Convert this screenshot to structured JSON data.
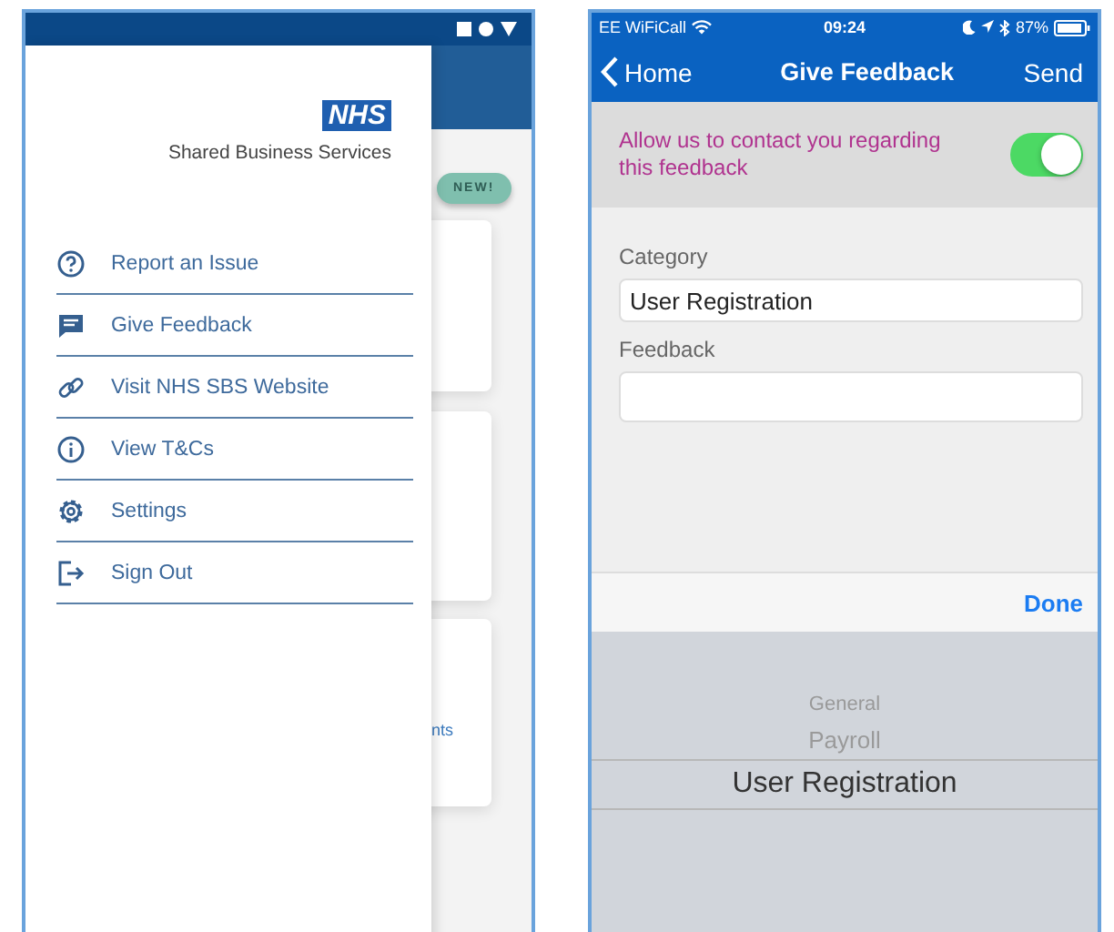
{
  "left_phone": {
    "logo": {
      "badge": "NHS",
      "name": "Shared Business Services"
    },
    "background": {
      "badge": "NEW!",
      "cut_text": "nts"
    },
    "menu": [
      {
        "label": "Report an Issue"
      },
      {
        "label": "Give Feedback"
      },
      {
        "label": "Visit NHS SBS Website"
      },
      {
        "label": "View T&Cs"
      },
      {
        "label": "Settings"
      },
      {
        "label": "Sign Out"
      }
    ]
  },
  "right_phone": {
    "status_bar": {
      "carrier": "EE WiFiCall",
      "time": "09:24",
      "battery": "87%"
    },
    "nav": {
      "back": "Home",
      "title": "Give Feedback",
      "action": "Send"
    },
    "contact_toggle": {
      "label": "Allow us to contact you regarding this feedback",
      "on": true
    },
    "fields": [
      {
        "label": "Category",
        "value": "User Registration"
      },
      {
        "label": "Feedback"
      }
    ],
    "toolbar": {
      "done": "Done"
    },
    "picker": [
      {
        "label": "General",
        "selected": false
      },
      {
        "label": "Payroll",
        "selected": false
      },
      {
        "label": "User Registration",
        "selected": true
      }
    ]
  }
}
